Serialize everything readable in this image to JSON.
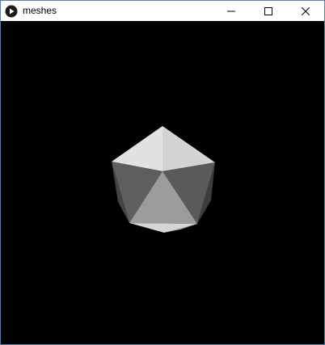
{
  "window": {
    "title": "meshes",
    "app_icon": "processing-play-icon",
    "controls": {
      "minimize_icon": "minimize-icon",
      "maximize_icon": "maximize-icon",
      "close_icon": "close-icon"
    }
  },
  "canvas": {
    "background": "#000000",
    "mesh": {
      "shape": "icosahedron",
      "colors": {
        "top_left": "#e2e2e2",
        "top_right": "#d4d4d4",
        "side_left": "#5e5e5e",
        "side_right": "#5a5a5a",
        "front": "#9c9c9c",
        "front_left_sliver": "#7a7a7a",
        "front_right_sliver": "#6e6e6e",
        "bottom": "#d6d6d6",
        "bottom_right": "#bdbdbd",
        "edge_left": "#444444",
        "edge_right": "#3c3c3c"
      }
    }
  }
}
